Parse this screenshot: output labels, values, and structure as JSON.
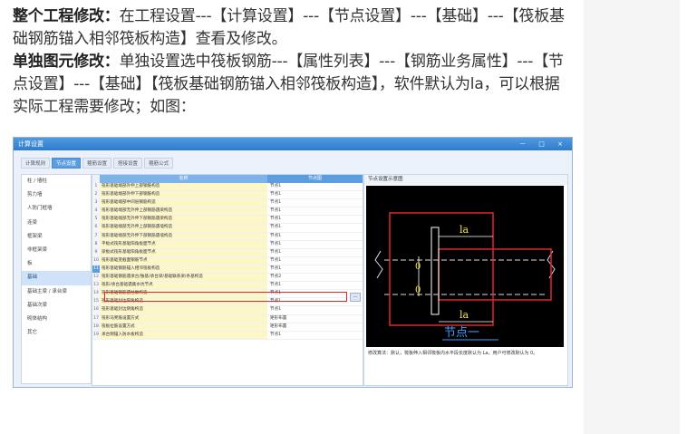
{
  "article": {
    "p1_bold": "整个工程修改：",
    "p1_text": "在工程设置---【计算设置】---【节点设置】---【基础】---【筏板基础钢筋锚入相邻筏板构造】查看及修改。",
    "p2_bold": "单独图元修改：",
    "p2_text": "单独设置选中筏板钢筋---【属性列表】---【钢筋业务属性】---【节点设置】---【基础】【筏板基础钢筋锚入相邻筏板构造】，软件默认为la，可以根据实际工程需要修改；如图："
  },
  "screenshot": {
    "window_title": "计算设置",
    "window_buttons": "－ □ ×",
    "tabs": [
      "计算规则",
      "节点设置",
      "箍筋设置",
      "搭接设置",
      "箍筋公式"
    ],
    "active_tab": 1,
    "sidebar": [
      "柱 / 墙柱",
      "剪力墙",
      "人防门框墙",
      "连梁",
      "框架梁",
      "非框架梁",
      "板",
      "基础",
      "基础主梁 / 承台梁",
      "基础次梁",
      "砌体结构",
      "其它"
    ],
    "sidebar_active": 7,
    "table": {
      "col_name": "名称",
      "col_value": "节点图",
      "rows": [
        {
          "n": "1",
          "name": "筏形基础端部外伸上部钢筋构造",
          "value": "节点1"
        },
        {
          "n": "2",
          "name": "筏形基础端部外伸下部钢筋构造",
          "value": "节点1"
        },
        {
          "n": "3",
          "name": "筏形基础端部中间层钢筋构造",
          "value": "节点1"
        },
        {
          "n": "4",
          "name": "筏形基础端部无外伸上部钢筋遇梁构造",
          "value": "节点1"
        },
        {
          "n": "5",
          "name": "筏形基础端部无外伸下部钢筋遇梁构造",
          "value": "节点1"
        },
        {
          "n": "6",
          "name": "筏形基础端部无外伸上部钢筋遇墙构造",
          "value": "节点1"
        },
        {
          "n": "7",
          "name": "筏形基础端部无外伸下部钢筋遇墙构造",
          "value": "节点1"
        },
        {
          "n": "8",
          "name": "平板式筏形基础阳角板面节点",
          "value": "节点1"
        },
        {
          "n": "9",
          "name": "梁板式筏形基础阳角板面节点",
          "value": "节点1"
        },
        {
          "n": "10",
          "name": "筏形基础变截面钢筋节点",
          "value": "节点1"
        },
        {
          "n": "11",
          "name": "筏形基础钢筋锚入相邻筏板构造",
          "value": "节点1"
        },
        {
          "n": "12",
          "name": "筏形基础钢筋遇承台/独基/承台梁/基础联系梁/条基构造",
          "value": "节点2"
        },
        {
          "n": "13",
          "name": "筏形/承台基础遇集水坑节点",
          "value": "节点1"
        },
        {
          "n": "14",
          "name": "筏形基础钢筋遇柱墩构造",
          "value": "节点1"
        },
        {
          "n": "15",
          "name": "筏形基础封边阳角构造",
          "value": "节点1"
        },
        {
          "n": "16",
          "name": "筏形基础封边阴角构造",
          "value": "节点1"
        },
        {
          "n": "17",
          "name": "筏形马凳筋设置方式",
          "value": "矩形布置"
        },
        {
          "n": "18",
          "name": "筏板拉筋设置方式",
          "value": "矩形布置"
        },
        {
          "n": "19",
          "name": "承台侧锚入防水板构造",
          "value": "节点1"
        }
      ],
      "selected_row": 10
    },
    "panel": {
      "title": "节点设置示意图",
      "label_la_top": "la",
      "label_la_bottom": "la",
      "label_zero": "0",
      "caption": "节点一",
      "description": "修改算法：默认，筏板伸入相邻筏板内水平段长度默认为 La，用户可修改默认为 0。"
    }
  }
}
